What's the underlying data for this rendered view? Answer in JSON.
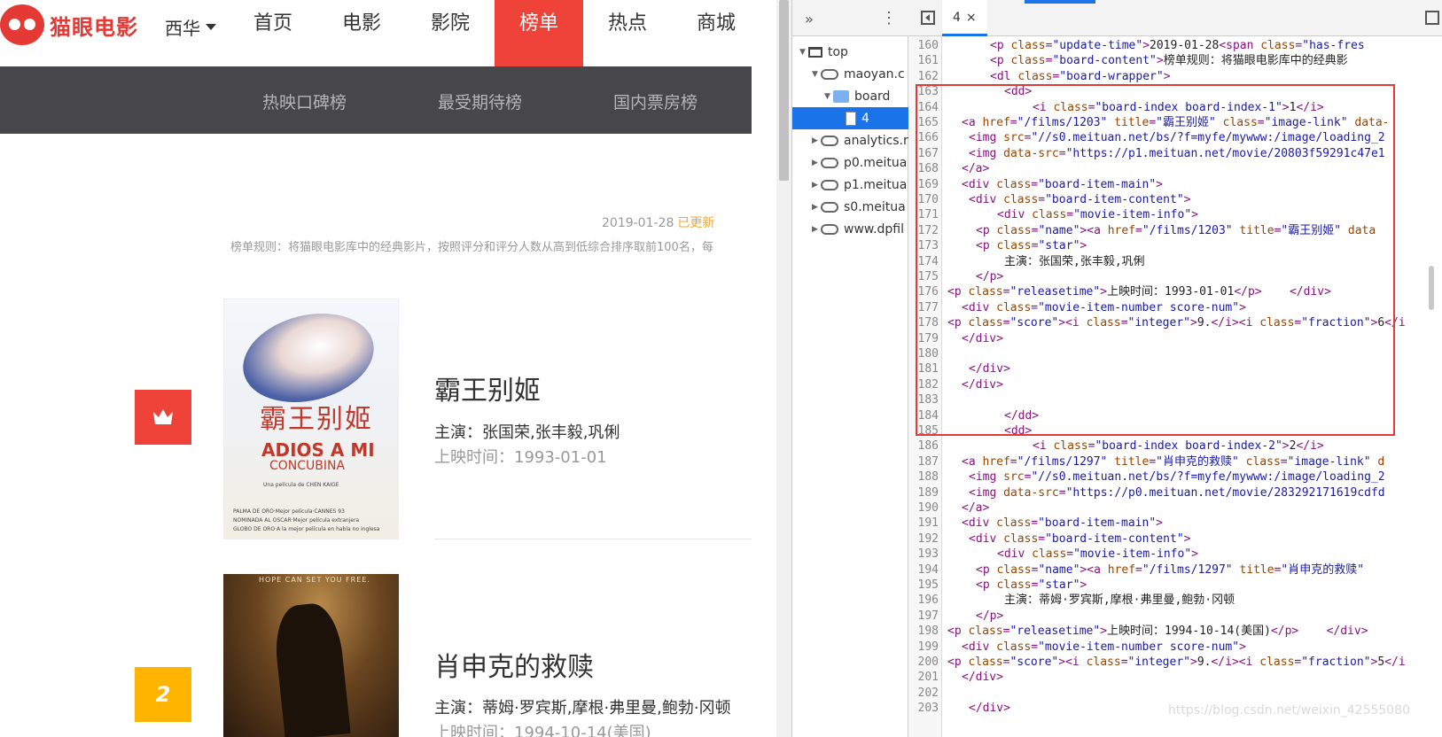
{
  "site": {
    "logo_text": "猫眼电影",
    "city": "西华",
    "nav": [
      "首页",
      "电影",
      "影院",
      "榜单",
      "热点",
      "商城"
    ],
    "active_nav": "榜单",
    "subnav": [
      "热映口碑榜",
      "最受期待榜",
      "国内票房榜"
    ],
    "update_date": "2019-01-28",
    "update_flag": "已更新",
    "rule": "榜单规则：将猫眼电影库中的经典影片，按照评分和评分人数从高到低综合排序取前100名，每"
  },
  "movies": [
    {
      "rank": "1",
      "name": "霸王别姬",
      "star": "主演：张国荣,张丰毅,巩俐",
      "time": "上映时间：1993-01-01",
      "poster": {
        "title": "霸王别姬",
        "en1": "ADIOS A MI",
        "en2": "CONCUBINA",
        "credit": "Una película de CHEN KAIGE",
        "lines": [
          "PALMA DE ORO·Mejor película·CANNES 93",
          "NOMINADA AL OSCAR·Mejor película extranjera",
          "GLOBO DE ORO·A la mejor película en habla no inglesa"
        ]
      }
    },
    {
      "rank": "2",
      "name": "肖申克的救赎",
      "star": "主演：蒂姆·罗宾斯,摩根·弗里曼,鲍勃·冈顿",
      "time": "上映时间：1994-10-14(美国)",
      "poster": {
        "tagline": "HOPE CAN SET YOU FREE."
      }
    }
  ],
  "devtools": {
    "tree": [
      {
        "label": "top",
        "icon": "frame-icon",
        "indent": 0,
        "expanded": true
      },
      {
        "label": "maoyan.c",
        "icon": "cloud-icon",
        "indent": 1,
        "expanded": true
      },
      {
        "label": "board",
        "icon": "folder-icon",
        "indent": 2,
        "expanded": true
      },
      {
        "label": "4",
        "icon": "file-icon",
        "indent": 3,
        "expanded": null,
        "selected": true
      },
      {
        "label": "analytics.r",
        "icon": "cloud-icon",
        "indent": 1,
        "expanded": false
      },
      {
        "label": "p0.meitua",
        "icon": "cloud-icon",
        "indent": 1,
        "expanded": false
      },
      {
        "label": "p1.meitua",
        "icon": "cloud-icon",
        "indent": 1,
        "expanded": false
      },
      {
        "label": "s0.meitua",
        "icon": "cloud-icon",
        "indent": 1,
        "expanded": false
      },
      {
        "label": "www.dpfil",
        "icon": "cloud-icon",
        "indent": 1,
        "expanded": false
      }
    ],
    "tab_label": "4",
    "tab_close": "×",
    "lines": [
      {
        "n": "160",
        "i": 6,
        "segs": [
          [
            "t",
            "<p "
          ],
          [
            "a",
            "class"
          ],
          [
            "t",
            "="
          ],
          [
            "v",
            "\"update-time\""
          ],
          [
            "t",
            ">"
          ],
          [
            "x",
            "2019-01-28"
          ],
          [
            "t",
            "<span "
          ],
          [
            "a",
            "class"
          ],
          [
            "t",
            "="
          ],
          [
            "v",
            "\"has-fres"
          ]
        ]
      },
      {
        "n": "161",
        "i": 6,
        "segs": [
          [
            "t",
            "<p "
          ],
          [
            "a",
            "class"
          ],
          [
            "t",
            "="
          ],
          [
            "v",
            "\"board-content\""
          ],
          [
            "t",
            ">"
          ],
          [
            "x",
            "榜单规则：将猫眼电影库中的经典影"
          ]
        ]
      },
      {
        "n": "162",
        "i": 6,
        "segs": [
          [
            "t",
            "<dl "
          ],
          [
            "a",
            "class"
          ],
          [
            "t",
            "="
          ],
          [
            "v",
            "\"board-wrapper\""
          ],
          [
            "t",
            ">"
          ]
        ]
      },
      {
        "n": "163",
        "i": 8,
        "segs": [
          [
            "t",
            "<dd>"
          ]
        ]
      },
      {
        "n": "164",
        "i": 12,
        "segs": [
          [
            "t",
            "<i "
          ],
          [
            "a",
            "class"
          ],
          [
            "t",
            "="
          ],
          [
            "v",
            "\"board-index board-index-1\""
          ],
          [
            "t",
            ">"
          ],
          [
            "x",
            "1"
          ],
          [
            "t",
            "</i>"
          ]
        ]
      },
      {
        "n": "165",
        "i": 2,
        "segs": [
          [
            "t",
            "<a "
          ],
          [
            "a",
            "href"
          ],
          [
            "t",
            "="
          ],
          [
            "v",
            "\"/films/1203\""
          ],
          [
            "t",
            " "
          ],
          [
            "a",
            "title"
          ],
          [
            "t",
            "="
          ],
          [
            "v",
            "\"霸王别姬\""
          ],
          [
            "t",
            " "
          ],
          [
            "a",
            "class"
          ],
          [
            "t",
            "="
          ],
          [
            "v",
            "\"image-link\""
          ],
          [
            "t",
            " "
          ],
          [
            "a",
            "data-"
          ]
        ]
      },
      {
        "n": "166",
        "i": 3,
        "segs": [
          [
            "t",
            "<img "
          ],
          [
            "a",
            "src"
          ],
          [
            "t",
            "="
          ],
          [
            "v",
            "\"//s0.meituan.net/bs/?f=myfe/mywww:/image/loading_2"
          ]
        ]
      },
      {
        "n": "167",
        "i": 3,
        "segs": [
          [
            "t",
            "<img "
          ],
          [
            "a",
            "data-src"
          ],
          [
            "t",
            "="
          ],
          [
            "v",
            "\"https://p1.meituan.net/movie/20803f59291c47e1"
          ]
        ]
      },
      {
        "n": "168",
        "i": 2,
        "segs": [
          [
            "t",
            "</a>"
          ]
        ]
      },
      {
        "n": "169",
        "i": 2,
        "segs": [
          [
            "t",
            "<div "
          ],
          [
            "a",
            "class"
          ],
          [
            "t",
            "="
          ],
          [
            "v",
            "\"board-item-main\""
          ],
          [
            "t",
            ">"
          ]
        ]
      },
      {
        "n": "170",
        "i": 3,
        "segs": [
          [
            "t",
            "<div "
          ],
          [
            "a",
            "class"
          ],
          [
            "t",
            "="
          ],
          [
            "v",
            "\"board-item-content\""
          ],
          [
            "t",
            ">"
          ]
        ]
      },
      {
        "n": "171",
        "i": 7,
        "segs": [
          [
            "t",
            "<div "
          ],
          [
            "a",
            "class"
          ],
          [
            "t",
            "="
          ],
          [
            "v",
            "\"movie-item-info\""
          ],
          [
            "t",
            ">"
          ]
        ]
      },
      {
        "n": "172",
        "i": 4,
        "segs": [
          [
            "t",
            "<p "
          ],
          [
            "a",
            "class"
          ],
          [
            "t",
            "="
          ],
          [
            "v",
            "\"name\""
          ],
          [
            "t",
            "><a "
          ],
          [
            "a",
            "href"
          ],
          [
            "t",
            "="
          ],
          [
            "v",
            "\"/films/1203\""
          ],
          [
            "t",
            " "
          ],
          [
            "a",
            "title"
          ],
          [
            "t",
            "="
          ],
          [
            "v",
            "\"霸王别姬\""
          ],
          [
            "t",
            " "
          ],
          [
            "a",
            "data"
          ]
        ]
      },
      {
        "n": "173",
        "i": 4,
        "segs": [
          [
            "t",
            "<p "
          ],
          [
            "a",
            "class"
          ],
          [
            "t",
            "="
          ],
          [
            "v",
            "\"star\""
          ],
          [
            "t",
            ">"
          ]
        ]
      },
      {
        "n": "174",
        "i": 8,
        "segs": [
          [
            "x",
            "主演：张国荣,张丰毅,巩俐"
          ]
        ]
      },
      {
        "n": "175",
        "i": 4,
        "segs": [
          [
            "t",
            "</p>"
          ]
        ]
      },
      {
        "n": "176",
        "i": 0,
        "segs": [
          [
            "t",
            "<p "
          ],
          [
            "a",
            "class"
          ],
          [
            "t",
            "="
          ],
          [
            "v",
            "\"releasetime\""
          ],
          [
            "t",
            ">"
          ],
          [
            "x",
            "上映时间：1993-01-01"
          ],
          [
            "t",
            "</p>"
          ],
          [
            "x",
            "    "
          ],
          [
            "t",
            "</div>"
          ]
        ]
      },
      {
        "n": "177",
        "i": 2,
        "segs": [
          [
            "t",
            "<div "
          ],
          [
            "a",
            "class"
          ],
          [
            "t",
            "="
          ],
          [
            "v",
            "\"movie-item-number score-num\""
          ],
          [
            "t",
            ">"
          ]
        ]
      },
      {
        "n": "178",
        "i": 0,
        "segs": [
          [
            "t",
            "<p "
          ],
          [
            "a",
            "class"
          ],
          [
            "t",
            "="
          ],
          [
            "v",
            "\"score\""
          ],
          [
            "t",
            "><i "
          ],
          [
            "a",
            "class"
          ],
          [
            "t",
            "="
          ],
          [
            "v",
            "\"integer\""
          ],
          [
            "t",
            ">"
          ],
          [
            "x",
            "9."
          ],
          [
            "t",
            "</i><i "
          ],
          [
            "a",
            "class"
          ],
          [
            "t",
            "="
          ],
          [
            "v",
            "\"fraction\""
          ],
          [
            "t",
            ">"
          ],
          [
            "x",
            "6"
          ],
          [
            "t",
            "</i"
          ]
        ]
      },
      {
        "n": "179",
        "i": 2,
        "segs": [
          [
            "t",
            "</div>"
          ]
        ]
      },
      {
        "n": "180",
        "i": 0,
        "segs": []
      },
      {
        "n": "181",
        "i": 3,
        "segs": [
          [
            "t",
            "</div>"
          ]
        ]
      },
      {
        "n": "182",
        "i": 2,
        "segs": [
          [
            "t",
            "</div>"
          ]
        ]
      },
      {
        "n": "183",
        "i": 0,
        "segs": []
      },
      {
        "n": "184",
        "i": 8,
        "segs": [
          [
            "t",
            "</dd>"
          ]
        ]
      },
      {
        "n": "185",
        "i": 8,
        "segs": [
          [
            "t",
            "<dd>"
          ]
        ]
      },
      {
        "n": "186",
        "i": 12,
        "segs": [
          [
            "t",
            "<i "
          ],
          [
            "a",
            "class"
          ],
          [
            "t",
            "="
          ],
          [
            "v",
            "\"board-index board-index-2\""
          ],
          [
            "t",
            ">"
          ],
          [
            "x",
            "2"
          ],
          [
            "t",
            "</i>"
          ]
        ]
      },
      {
        "n": "187",
        "i": 2,
        "segs": [
          [
            "t",
            "<a "
          ],
          [
            "a",
            "href"
          ],
          [
            "t",
            "="
          ],
          [
            "v",
            "\"/films/1297\""
          ],
          [
            "t",
            " "
          ],
          [
            "a",
            "title"
          ],
          [
            "t",
            "="
          ],
          [
            "v",
            "\"肖申克的救赎\""
          ],
          [
            "t",
            " "
          ],
          [
            "a",
            "class"
          ],
          [
            "t",
            "="
          ],
          [
            "v",
            "\"image-link\""
          ],
          [
            "t",
            " "
          ],
          [
            "a",
            "d"
          ]
        ]
      },
      {
        "n": "188",
        "i": 3,
        "segs": [
          [
            "t",
            "<img "
          ],
          [
            "a",
            "src"
          ],
          [
            "t",
            "="
          ],
          [
            "v",
            "\"//s0.meituan.net/bs/?f=myfe/mywww:/image/loading_2"
          ]
        ]
      },
      {
        "n": "189",
        "i": 3,
        "segs": [
          [
            "t",
            "<img "
          ],
          [
            "a",
            "data-src"
          ],
          [
            "t",
            "="
          ],
          [
            "v",
            "\"https://p0.meituan.net/movie/283292171619cdfd"
          ]
        ]
      },
      {
        "n": "190",
        "i": 2,
        "segs": [
          [
            "t",
            "</a>"
          ]
        ]
      },
      {
        "n": "191",
        "i": 2,
        "segs": [
          [
            "t",
            "<div "
          ],
          [
            "a",
            "class"
          ],
          [
            "t",
            "="
          ],
          [
            "v",
            "\"board-item-main\""
          ],
          [
            "t",
            ">"
          ]
        ]
      },
      {
        "n": "192",
        "i": 3,
        "segs": [
          [
            "t",
            "<div "
          ],
          [
            "a",
            "class"
          ],
          [
            "t",
            "="
          ],
          [
            "v",
            "\"board-item-content\""
          ],
          [
            "t",
            ">"
          ]
        ]
      },
      {
        "n": "193",
        "i": 7,
        "segs": [
          [
            "t",
            "<div "
          ],
          [
            "a",
            "class"
          ],
          [
            "t",
            "="
          ],
          [
            "v",
            "\"movie-item-info\""
          ],
          [
            "t",
            ">"
          ]
        ]
      },
      {
        "n": "194",
        "i": 4,
        "segs": [
          [
            "t",
            "<p "
          ],
          [
            "a",
            "class"
          ],
          [
            "t",
            "="
          ],
          [
            "v",
            "\"name\""
          ],
          [
            "t",
            "><a "
          ],
          [
            "a",
            "href"
          ],
          [
            "t",
            "="
          ],
          [
            "v",
            "\"/films/1297\""
          ],
          [
            "t",
            " "
          ],
          [
            "a",
            "title"
          ],
          [
            "t",
            "="
          ],
          [
            "v",
            "\"肖申克的救赎\""
          ]
        ]
      },
      {
        "n": "195",
        "i": 4,
        "segs": [
          [
            "t",
            "<p "
          ],
          [
            "a",
            "class"
          ],
          [
            "t",
            "="
          ],
          [
            "v",
            "\"star\""
          ],
          [
            "t",
            ">"
          ]
        ]
      },
      {
        "n": "196",
        "i": 8,
        "segs": [
          [
            "x",
            "主演：蒂姆·罗宾斯,摩根·弗里曼,鲍勃·冈顿"
          ]
        ]
      },
      {
        "n": "197",
        "i": 4,
        "segs": [
          [
            "t",
            "</p>"
          ]
        ]
      },
      {
        "n": "198",
        "i": 0,
        "segs": [
          [
            "t",
            "<p "
          ],
          [
            "a",
            "class"
          ],
          [
            "t",
            "="
          ],
          [
            "v",
            "\"releasetime\""
          ],
          [
            "t",
            ">"
          ],
          [
            "x",
            "上映时间：1994-10-14(美国)"
          ],
          [
            "t",
            "</p>"
          ],
          [
            "x",
            "    "
          ],
          [
            "t",
            "</div>"
          ]
        ]
      },
      {
        "n": "199",
        "i": 2,
        "segs": [
          [
            "t",
            "<div "
          ],
          [
            "a",
            "class"
          ],
          [
            "t",
            "="
          ],
          [
            "v",
            "\"movie-item-number score-num\""
          ],
          [
            "t",
            ">"
          ]
        ]
      },
      {
        "n": "200",
        "i": 0,
        "segs": [
          [
            "t",
            "<p "
          ],
          [
            "a",
            "class"
          ],
          [
            "t",
            "="
          ],
          [
            "v",
            "\"score\""
          ],
          [
            "t",
            "><i "
          ],
          [
            "a",
            "class"
          ],
          [
            "t",
            "="
          ],
          [
            "v",
            "\"integer\""
          ],
          [
            "t",
            ">"
          ],
          [
            "x",
            "9."
          ],
          [
            "t",
            "</i><i "
          ],
          [
            "a",
            "class"
          ],
          [
            "t",
            "="
          ],
          [
            "v",
            "\"fraction\""
          ],
          [
            "t",
            ">"
          ],
          [
            "x",
            "5"
          ],
          [
            "t",
            "</i"
          ]
        ]
      },
      {
        "n": "201",
        "i": 2,
        "segs": [
          [
            "t",
            "</div>"
          ]
        ]
      },
      {
        "n": "202",
        "i": 0,
        "segs": []
      },
      {
        "n": "203",
        "i": 3,
        "segs": [
          [
            "t",
            "</div>"
          ]
        ]
      }
    ]
  },
  "watermark": "https://blog.csdn.net/weixin_42555080"
}
